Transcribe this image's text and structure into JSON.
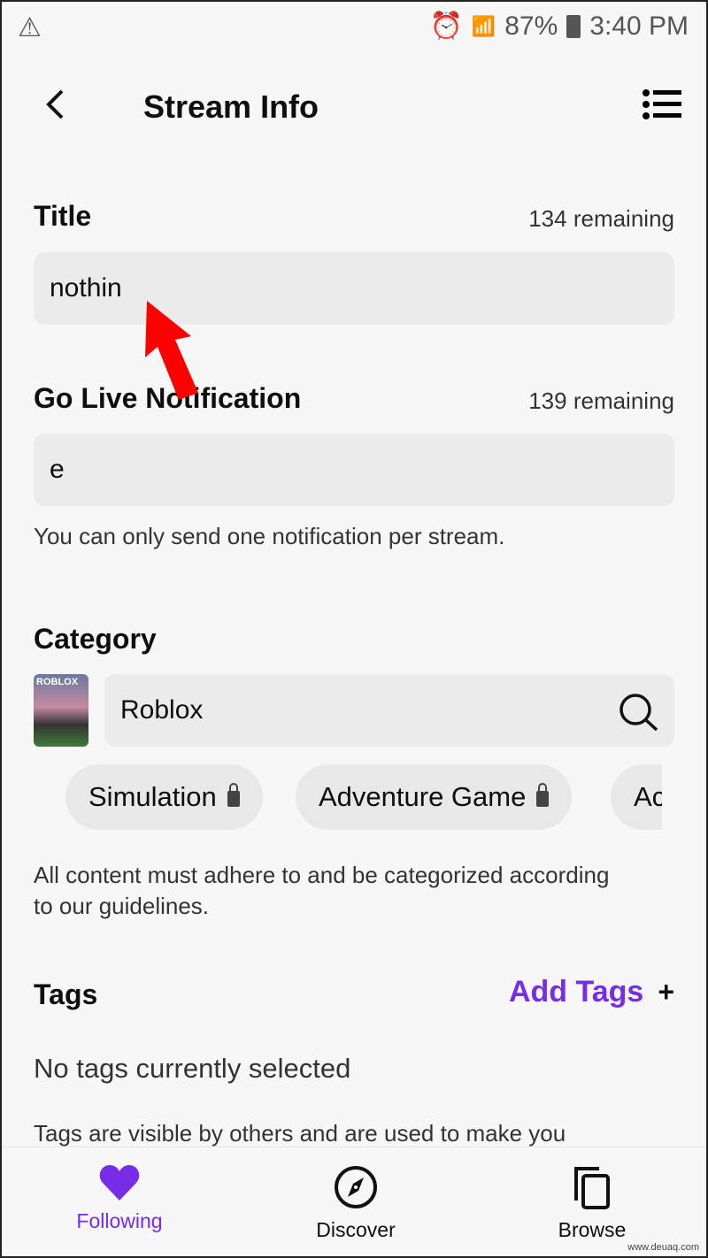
{
  "status_bar": {
    "battery": "87%",
    "time": "3:40 PM"
  },
  "header": {
    "title": "Stream Info"
  },
  "title_field": {
    "label": "Title",
    "remaining": "134 remaining",
    "value": "nothin"
  },
  "notification_field": {
    "label": "Go Live Notification",
    "remaining": "139 remaining",
    "value": "e",
    "note": "You can only send one notification per stream."
  },
  "category": {
    "label": "Category",
    "value": "Roblox",
    "thumbnail_text": "ROBLOX",
    "tags": [
      "Simulation",
      "Adventure Game",
      "Ac"
    ],
    "note": "All content must adhere to and be categorized according to our guidelines."
  },
  "tags": {
    "label": "Tags",
    "add_label": "Add Tags",
    "empty": "No tags currently selected",
    "note": "Tags are visible by others and are used to make you"
  },
  "bottom_nav": [
    {
      "label": "Following",
      "icon": "heart-icon",
      "active": true
    },
    {
      "label": "Discover",
      "icon": "compass-icon"
    },
    {
      "label": "Browse",
      "icon": "copy-icon"
    }
  ],
  "colors": {
    "accent": "#772ce8",
    "annotation": "#ff0000"
  },
  "watermark": "www.deuaq.com"
}
